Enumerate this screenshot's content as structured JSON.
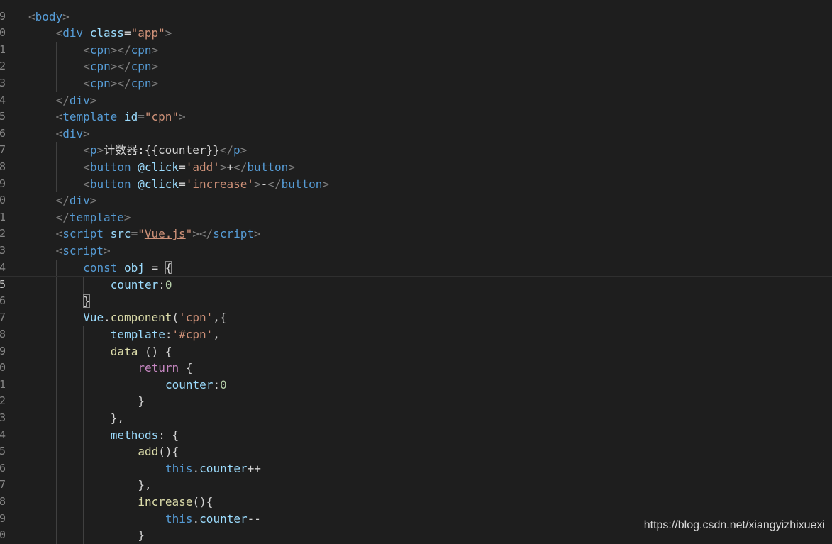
{
  "editor": {
    "current_line_index": 17,
    "lines": [
      {
        "ln": "",
        "indent": 0,
        "tokens": [
          {
            "t": "",
            "c": "plain"
          }
        ]
      },
      {
        "ln": "9",
        "indent": 0,
        "tokens": [
          {
            "t": "<",
            "c": "punc"
          },
          {
            "t": "body",
            "c": "tag"
          },
          {
            "t": ">",
            "c": "punc"
          }
        ]
      },
      {
        "ln": "0",
        "indent": 1,
        "tokens": [
          {
            "t": "<",
            "c": "punc"
          },
          {
            "t": "div",
            "c": "tag"
          },
          {
            "t": " class",
            "c": "attr"
          },
          {
            "t": "=",
            "c": "plain"
          },
          {
            "t": "\"app\"",
            "c": "str"
          },
          {
            "t": ">",
            "c": "punc"
          }
        ]
      },
      {
        "ln": "1",
        "indent": 2,
        "tokens": [
          {
            "t": "<",
            "c": "punc"
          },
          {
            "t": "cpn",
            "c": "tag"
          },
          {
            "t": "></",
            "c": "punc"
          },
          {
            "t": "cpn",
            "c": "tag"
          },
          {
            "t": ">",
            "c": "punc"
          }
        ]
      },
      {
        "ln": "2",
        "indent": 2,
        "tokens": [
          {
            "t": "<",
            "c": "punc"
          },
          {
            "t": "cpn",
            "c": "tag"
          },
          {
            "t": "></",
            "c": "punc"
          },
          {
            "t": "cpn",
            "c": "tag"
          },
          {
            "t": ">",
            "c": "punc"
          }
        ]
      },
      {
        "ln": "3",
        "indent": 2,
        "tokens": [
          {
            "t": "<",
            "c": "punc"
          },
          {
            "t": "cpn",
            "c": "tag"
          },
          {
            "t": "></",
            "c": "punc"
          },
          {
            "t": "cpn",
            "c": "tag"
          },
          {
            "t": ">",
            "c": "punc"
          }
        ]
      },
      {
        "ln": "4",
        "indent": 1,
        "tokens": [
          {
            "t": "</",
            "c": "punc"
          },
          {
            "t": "div",
            "c": "tag"
          },
          {
            "t": ">",
            "c": "punc"
          }
        ]
      },
      {
        "ln": "5",
        "indent": 1,
        "tokens": [
          {
            "t": "<",
            "c": "punc"
          },
          {
            "t": "template",
            "c": "tag"
          },
          {
            "t": " id",
            "c": "attr"
          },
          {
            "t": "=",
            "c": "plain"
          },
          {
            "t": "\"cpn\"",
            "c": "str"
          },
          {
            "t": ">",
            "c": "punc"
          }
        ]
      },
      {
        "ln": "6",
        "indent": 1,
        "tokens": [
          {
            "t": "<",
            "c": "punc"
          },
          {
            "t": "div",
            "c": "tag"
          },
          {
            "t": ">",
            "c": "punc"
          }
        ]
      },
      {
        "ln": "7",
        "indent": 2,
        "tokens": [
          {
            "t": "<",
            "c": "punc"
          },
          {
            "t": "p",
            "c": "tag"
          },
          {
            "t": ">",
            "c": "punc"
          },
          {
            "t": "计数器",
            "c": "plain cjk"
          },
          {
            "t": ":{{counter}}",
            "c": "plain"
          },
          {
            "t": "</",
            "c": "punc"
          },
          {
            "t": "p",
            "c": "tag"
          },
          {
            "t": ">",
            "c": "punc"
          }
        ]
      },
      {
        "ln": "8",
        "indent": 2,
        "tokens": [
          {
            "t": "<",
            "c": "punc"
          },
          {
            "t": "button",
            "c": "tag"
          },
          {
            "t": " @click",
            "c": "attr"
          },
          {
            "t": "=",
            "c": "plain"
          },
          {
            "t": "'add'",
            "c": "str"
          },
          {
            "t": ">",
            "c": "punc"
          },
          {
            "t": "+",
            "c": "plain"
          },
          {
            "t": "</",
            "c": "punc"
          },
          {
            "t": "button",
            "c": "tag"
          },
          {
            "t": ">",
            "c": "punc"
          }
        ]
      },
      {
        "ln": "9",
        "indent": 2,
        "tokens": [
          {
            "t": "<",
            "c": "punc"
          },
          {
            "t": "button",
            "c": "tag"
          },
          {
            "t": " @click",
            "c": "attr"
          },
          {
            "t": "=",
            "c": "plain"
          },
          {
            "t": "'increase'",
            "c": "str"
          },
          {
            "t": ">",
            "c": "punc"
          },
          {
            "t": "-",
            "c": "plain"
          },
          {
            "t": "</",
            "c": "punc"
          },
          {
            "t": "button",
            "c": "tag"
          },
          {
            "t": ">",
            "c": "punc"
          }
        ]
      },
      {
        "ln": "0",
        "indent": 1,
        "tokens": [
          {
            "t": "</",
            "c": "punc"
          },
          {
            "t": "div",
            "c": "tag"
          },
          {
            "t": ">",
            "c": "punc"
          }
        ]
      },
      {
        "ln": "1",
        "indent": 1,
        "tokens": [
          {
            "t": "</",
            "c": "punc"
          },
          {
            "t": "template",
            "c": "tag"
          },
          {
            "t": ">",
            "c": "punc"
          }
        ]
      },
      {
        "ln": "2",
        "indent": 1,
        "tokens": [
          {
            "t": "<",
            "c": "punc"
          },
          {
            "t": "script",
            "c": "tag"
          },
          {
            "t": " src",
            "c": "attr"
          },
          {
            "t": "=",
            "c": "plain"
          },
          {
            "t": "\"",
            "c": "str"
          },
          {
            "t": "Vue.js",
            "c": "str link-ul"
          },
          {
            "t": "\"",
            "c": "str"
          },
          {
            "t": "></",
            "c": "punc"
          },
          {
            "t": "script",
            "c": "tag"
          },
          {
            "t": ">",
            "c": "punc"
          }
        ]
      },
      {
        "ln": "3",
        "indent": 1,
        "tokens": [
          {
            "t": "<",
            "c": "punc"
          },
          {
            "t": "script",
            "c": "tag"
          },
          {
            "t": ">",
            "c": "punc"
          }
        ]
      },
      {
        "ln": "4",
        "indent": 2,
        "tokens": [
          {
            "t": "const",
            "c": "kw"
          },
          {
            "t": " ",
            "c": "plain"
          },
          {
            "t": "obj",
            "c": "cls"
          },
          {
            "t": " = ",
            "c": "plain"
          },
          {
            "t": "{",
            "c": "plain bracket-box"
          }
        ]
      },
      {
        "ln": "5",
        "indent": 3,
        "tokens": [
          {
            "t": "counter",
            "c": "prop"
          },
          {
            "t": ":",
            "c": "plain"
          },
          {
            "t": "0",
            "c": "num"
          }
        ]
      },
      {
        "ln": "6",
        "indent": 2,
        "tokens": [
          {
            "t": "}",
            "c": "plain bracket-box"
          }
        ]
      },
      {
        "ln": "7",
        "indent": 2,
        "tokens": [
          {
            "t": "Vue",
            "c": "cls"
          },
          {
            "t": ".",
            "c": "plain"
          },
          {
            "t": "component",
            "c": "fn"
          },
          {
            "t": "(",
            "c": "plain"
          },
          {
            "t": "'cpn'",
            "c": "str"
          },
          {
            "t": ",{",
            "c": "plain"
          }
        ]
      },
      {
        "ln": "8",
        "indent": 3,
        "tokens": [
          {
            "t": "template",
            "c": "prop"
          },
          {
            "t": ":",
            "c": "plain"
          },
          {
            "t": "'#cpn'",
            "c": "str"
          },
          {
            "t": ",",
            "c": "plain"
          }
        ]
      },
      {
        "ln": "9",
        "indent": 3,
        "tokens": [
          {
            "t": "data",
            "c": "fn"
          },
          {
            "t": " () {",
            "c": "plain"
          }
        ]
      },
      {
        "ln": "0",
        "indent": 4,
        "tokens": [
          {
            "t": "return",
            "c": "ctrl"
          },
          {
            "t": " {",
            "c": "plain"
          }
        ]
      },
      {
        "ln": "1",
        "indent": 5,
        "tokens": [
          {
            "t": "counter",
            "c": "prop"
          },
          {
            "t": ":",
            "c": "plain"
          },
          {
            "t": "0",
            "c": "num"
          }
        ]
      },
      {
        "ln": "2",
        "indent": 4,
        "tokens": [
          {
            "t": "}",
            "c": "plain"
          }
        ]
      },
      {
        "ln": "3",
        "indent": 3,
        "tokens": [
          {
            "t": "},",
            "c": "plain"
          }
        ]
      },
      {
        "ln": "4",
        "indent": 3,
        "tokens": [
          {
            "t": "methods",
            "c": "prop"
          },
          {
            "t": ": {",
            "c": "plain"
          }
        ]
      },
      {
        "ln": "5",
        "indent": 4,
        "tokens": [
          {
            "t": "add",
            "c": "fn"
          },
          {
            "t": "(){",
            "c": "plain"
          }
        ]
      },
      {
        "ln": "6",
        "indent": 5,
        "tokens": [
          {
            "t": "this",
            "c": "kw"
          },
          {
            "t": ".",
            "c": "plain"
          },
          {
            "t": "counter",
            "c": "prop"
          },
          {
            "t": "++",
            "c": "plain"
          }
        ]
      },
      {
        "ln": "7",
        "indent": 4,
        "tokens": [
          {
            "t": "},",
            "c": "plain"
          }
        ]
      },
      {
        "ln": "8",
        "indent": 4,
        "tokens": [
          {
            "t": "increase",
            "c": "fn"
          },
          {
            "t": "(){",
            "c": "plain"
          }
        ]
      },
      {
        "ln": "9",
        "indent": 5,
        "tokens": [
          {
            "t": "this",
            "c": "kw"
          },
          {
            "t": ".",
            "c": "plain"
          },
          {
            "t": "counter",
            "c": "prop"
          },
          {
            "t": "--",
            "c": "plain"
          }
        ]
      },
      {
        "ln": "0",
        "indent": 4,
        "tokens": [
          {
            "t": "}",
            "c": "plain"
          }
        ]
      }
    ]
  },
  "watermark": "https://blog.csdn.net/xiangyizhixuexi"
}
